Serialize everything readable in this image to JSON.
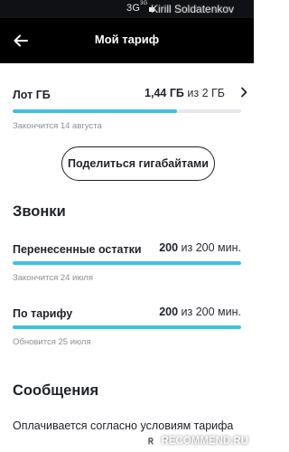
{
  "status_bar": {
    "network": "3G",
    "network_sup": "3G",
    "user_name": "Kirill Soldatenkov"
  },
  "app_bar": {
    "back_icon": "arrow-left-icon",
    "title": "Мой тариф"
  },
  "internet": {
    "label": "Лот ГБ",
    "used": "1,44 ГБ",
    "of_total": "из 2 ГБ",
    "progress": 0.72,
    "note": "Закончится 14 августа",
    "chevron_icon": "chevron-right-icon"
  },
  "share_button": {
    "label": "Поделиться гигабайтами"
  },
  "calls": {
    "title": "Звонки",
    "items": [
      {
        "label": "Перенесенные остатки",
        "amount": "200",
        "of_total": "из 200 мин.",
        "progress": 1.0,
        "note": "Закончится 24 июля"
      },
      {
        "label": "По тарифу",
        "amount": "200",
        "of_total": "из 200 мин.",
        "progress": 1.0,
        "note": "Обновится 25 июля"
      }
    ]
  },
  "messages": {
    "title": "Сообщения",
    "text": "Оплачивается согласно условиям тарифа"
  },
  "watermark": {
    "text": "RECOMMEND.RU"
  },
  "colors": {
    "accent": "#3fc1e3",
    "track": "#e6e8ec",
    "app_bar": "#000000",
    "text": "#1f2229",
    "muted": "#8d9096"
  }
}
